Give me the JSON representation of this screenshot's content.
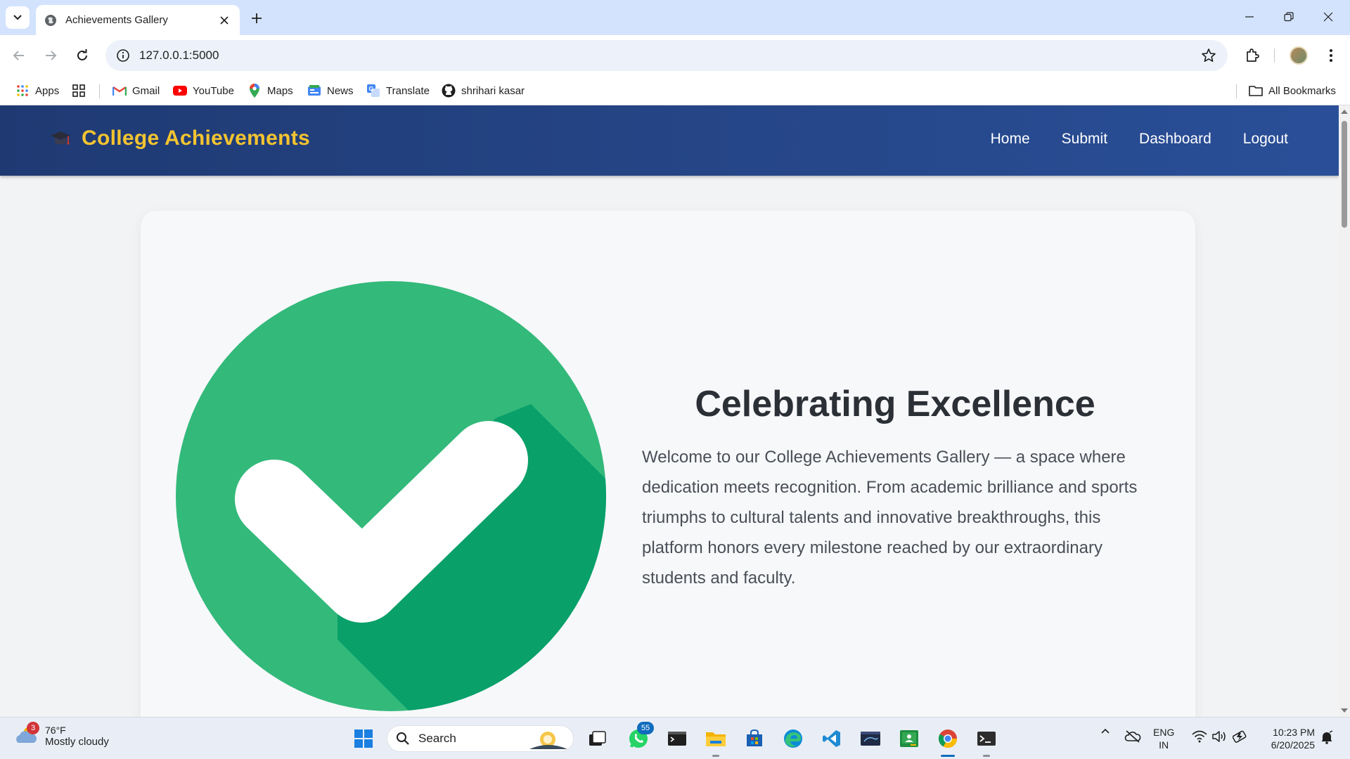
{
  "browser": {
    "tab_title": "Achievements Gallery",
    "url": "127.0.0.1:5000",
    "bookmarks": [
      {
        "label": "Apps",
        "icon": "apps-grid-icon"
      },
      {
        "label": "Gmail",
        "icon": "gmail-icon"
      },
      {
        "label": "YouTube",
        "icon": "youtube-icon"
      },
      {
        "label": "Maps",
        "icon": "maps-icon"
      },
      {
        "label": "News",
        "icon": "news-icon"
      },
      {
        "label": "Translate",
        "icon": "translate-icon"
      },
      {
        "label": "shrihari kasar",
        "icon": "github-icon"
      }
    ],
    "all_bookmarks_label": "All Bookmarks"
  },
  "site": {
    "brand": "College Achievements",
    "brand_color": "#f4c430",
    "header_color": "#1f3a73",
    "nav": [
      "Home",
      "Submit",
      "Dashboard",
      "Logout"
    ]
  },
  "hero": {
    "heading": "Celebrating Excellence",
    "body": "Welcome to our College Achievements Gallery — a space where dedication meets recognition. From academic brilliance and sports triumphs to cultural talents and innovative breakthroughs, this platform honors every milestone reached by our extraordinary students and faculty.",
    "image_icon": "checkmark-circle-icon",
    "accent_color": "#33b97a"
  },
  "taskbar": {
    "weather_badge": "3",
    "temperature": "76°F",
    "condition": "Mostly cloudy",
    "search_placeholder": "Search",
    "whatsapp_badge": "55",
    "language_line1": "ENG",
    "language_line2": "IN",
    "time": "10:23 PM",
    "date": "6/20/2025"
  }
}
